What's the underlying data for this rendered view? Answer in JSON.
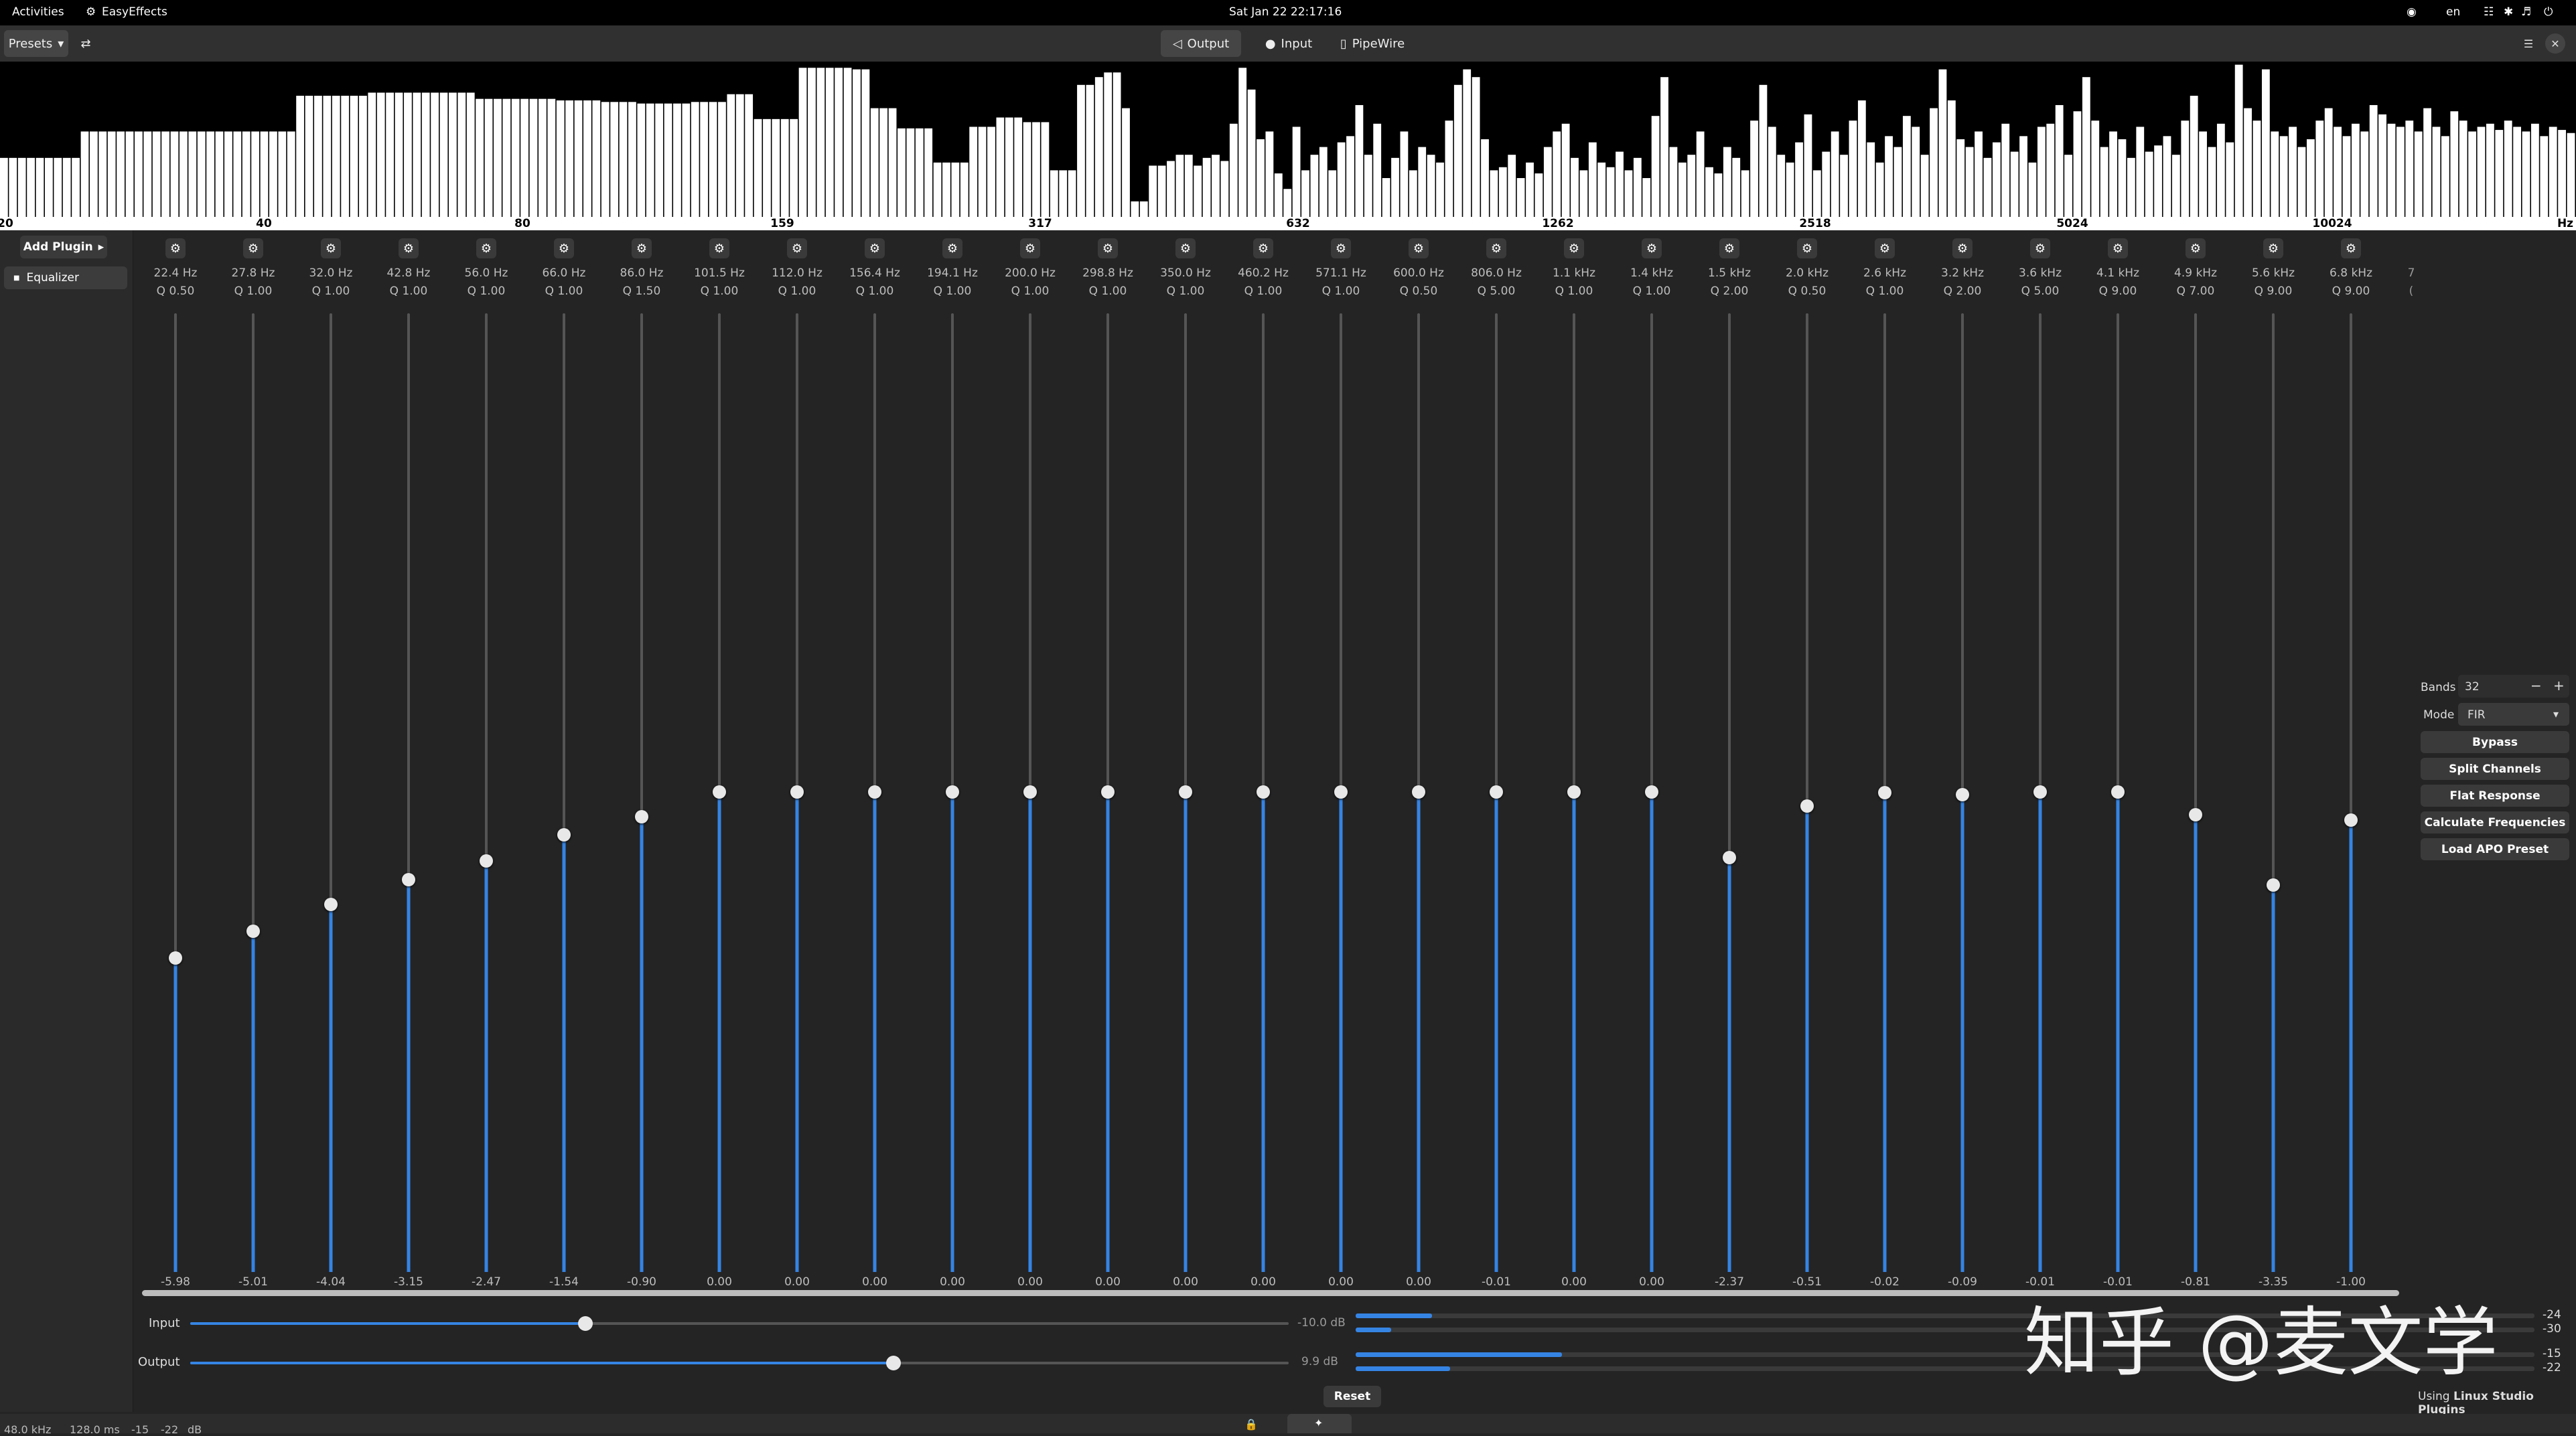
{
  "topbar": {
    "activities": "Activities",
    "app_name": "EasyEffects",
    "clock": "Sat Jan 22  22:17:16",
    "lang": "en"
  },
  "header": {
    "presets_label": "Presets",
    "tabs": [
      {
        "label": "Output",
        "icon": "speaker-icon",
        "active": true
      },
      {
        "label": "Input",
        "icon": "microphone-icon",
        "active": false
      },
      {
        "label": "PipeWire",
        "icon": "pipewire-icon",
        "active": false
      }
    ]
  },
  "spectrum": {
    "ticks": [
      "20",
      "40",
      "80",
      "159",
      "317",
      "632",
      "1262",
      "2518",
      "5024",
      "10024",
      "Hz"
    ],
    "levels": [
      0.38,
      0.38,
      0.38,
      0.38,
      0.38,
      0.38,
      0.38,
      0.38,
      0.38,
      0.55,
      0.55,
      0.55,
      0.55,
      0.55,
      0.55,
      0.55,
      0.55,
      0.55,
      0.55,
      0.55,
      0.55,
      0.55,
      0.55,
      0.55,
      0.55,
      0.55,
      0.55,
      0.55,
      0.55,
      0.55,
      0.55,
      0.55,
      0.55,
      0.78,
      0.78,
      0.78,
      0.78,
      0.78,
      0.78,
      0.78,
      0.78,
      0.8,
      0.8,
      0.8,
      0.8,
      0.8,
      0.8,
      0.8,
      0.8,
      0.8,
      0.8,
      0.8,
      0.8,
      0.76,
      0.76,
      0.76,
      0.76,
      0.76,
      0.76,
      0.76,
      0.76,
      0.76,
      0.75,
      0.75,
      0.75,
      0.75,
      0.75,
      0.74,
      0.74,
      0.74,
      0.74,
      0.73,
      0.73,
      0.73,
      0.73,
      0.73,
      0.73,
      0.74,
      0.74,
      0.74,
      0.74,
      0.79,
      0.79,
      0.79,
      0.63,
      0.63,
      0.63,
      0.63,
      0.63,
      0.96,
      0.96,
      0.96,
      0.96,
      0.96,
      0.96,
      0.95,
      0.95,
      0.7,
      0.7,
      0.7,
      0.57,
      0.57,
      0.57,
      0.57,
      0.35,
      0.35,
      0.35,
      0.35,
      0.58,
      0.58,
      0.58,
      0.64,
      0.64,
      0.64,
      0.61,
      0.61,
      0.61,
      0.3,
      0.3,
      0.3,
      0.85,
      0.85,
      0.9,
      0.93,
      0.93,
      0.7,
      0.1,
      0.1,
      0.33,
      0.33,
      0.36,
      0.4,
      0.4,
      0.33,
      0.38,
      0.4,
      0.36,
      0.6,
      0.96,
      0.82,
      0.5,
      0.55,
      0.28,
      0.18,
      0.58,
      0.3,
      0.4,
      0.45,
      0.3,
      0.48,
      0.52,
      0.72,
      0.4,
      0.6,
      0.25,
      0.38,
      0.55,
      0.3,
      0.45,
      0.4,
      0.35,
      0.62,
      0.85,
      0.95,
      0.9,
      0.5,
      0.3,
      0.32,
      0.4,
      0.25,
      0.35,
      0.28,
      0.45,
      0.55,
      0.6,
      0.38,
      0.3,
      0.48,
      0.35,
      0.32,
      0.42,
      0.3,
      0.38,
      0.25,
      0.65,
      0.9,
      0.45,
      0.35,
      0.4,
      0.55,
      0.32,
      0.28,
      0.45,
      0.38,
      0.3,
      0.62,
      0.85,
      0.58,
      0.4,
      0.35,
      0.48,
      0.66,
      0.3,
      0.42,
      0.55,
      0.4,
      0.62,
      0.75,
      0.48,
      0.35,
      0.52,
      0.45,
      0.65,
      0.58,
      0.4,
      0.7,
      0.95,
      0.75,
      0.5,
      0.45,
      0.55,
      0.38,
      0.48,
      0.6,
      0.42,
      0.52,
      0.35,
      0.58,
      0.6,
      0.72,
      0.4,
      0.68,
      0.9,
      0.62,
      0.45,
      0.55,
      0.5,
      0.38,
      0.58,
      0.42,
      0.46,
      0.52,
      0.4,
      0.62,
      0.78,
      0.55,
      0.45,
      0.6,
      0.48,
      0.98,
      0.7,
      0.62,
      0.95,
      0.55,
      0.52,
      0.58,
      0.45,
      0.5,
      0.62,
      0.7,
      0.58,
      0.52,
      0.6,
      0.55,
      0.72,
      0.66,
      0.6,
      0.58,
      0.62,
      0.55,
      0.7,
      0.58,
      0.52,
      0.68,
      0.62,
      0.55,
      0.58,
      0.6,
      0.56,
      0.62,
      0.58,
      0.55,
      0.6,
      0.52,
      0.58,
      0.56,
      0.54
    ]
  },
  "sidebar": {
    "add_plugin_label": "Add Plugin",
    "plugins": [
      "Equalizer"
    ]
  },
  "bands": [
    {
      "freq": "22.4 Hz",
      "q": "Q 0.50",
      "gain": "-5.98",
      "value": -5.98
    },
    {
      "freq": "27.8 Hz",
      "q": "Q 1.00",
      "gain": "-5.01",
      "value": -5.01
    },
    {
      "freq": "32.0 Hz",
      "q": "Q 1.00",
      "gain": "-4.04",
      "value": -4.04
    },
    {
      "freq": "42.8 Hz",
      "q": "Q 1.00",
      "gain": "-3.15",
      "value": -3.15
    },
    {
      "freq": "56.0 Hz",
      "q": "Q 1.00",
      "gain": "-2.47",
      "value": -2.47
    },
    {
      "freq": "66.0 Hz",
      "q": "Q 1.00",
      "gain": "-1.54",
      "value": -1.54
    },
    {
      "freq": "86.0 Hz",
      "q": "Q 1.50",
      "gain": "-0.90",
      "value": -0.9
    },
    {
      "freq": "101.5 Hz",
      "q": "Q 1.00",
      "gain": "0.00",
      "value": 0.0
    },
    {
      "freq": "112.0 Hz",
      "q": "Q 1.00",
      "gain": "0.00",
      "value": 0.0
    },
    {
      "freq": "156.4 Hz",
      "q": "Q 1.00",
      "gain": "0.00",
      "value": 0.0
    },
    {
      "freq": "194.1 Hz",
      "q": "Q 1.00",
      "gain": "0.00",
      "value": 0.0
    },
    {
      "freq": "200.0 Hz",
      "q": "Q 1.00",
      "gain": "0.00",
      "value": 0.0
    },
    {
      "freq": "298.8 Hz",
      "q": "Q 1.00",
      "gain": "0.00",
      "value": 0.0
    },
    {
      "freq": "350.0 Hz",
      "q": "Q 1.00",
      "gain": "0.00",
      "value": 0.0
    },
    {
      "freq": "460.2 Hz",
      "q": "Q 1.00",
      "gain": "0.00",
      "value": 0.0
    },
    {
      "freq": "571.1 Hz",
      "q": "Q 1.00",
      "gain": "0.00",
      "value": 0.0
    },
    {
      "freq": "600.0 Hz",
      "q": "Q 0.50",
      "gain": "0.00",
      "value": 0.0
    },
    {
      "freq": "806.0 Hz",
      "q": "Q 5.00",
      "gain": "-0.01",
      "value": -0.01
    },
    {
      "freq": "1.1 kHz",
      "q": "Q 1.00",
      "gain": "0.00",
      "value": 0.0
    },
    {
      "freq": "1.4 kHz",
      "q": "Q 1.00",
      "gain": "0.00",
      "value": 0.0
    },
    {
      "freq": "1.5 kHz",
      "q": "Q 2.00",
      "gain": "-2.37",
      "value": -2.37
    },
    {
      "freq": "2.0 kHz",
      "q": "Q 0.50",
      "gain": "-0.51",
      "value": -0.51
    },
    {
      "freq": "2.6 kHz",
      "q": "Q 1.00",
      "gain": "-0.02",
      "value": -0.02
    },
    {
      "freq": "3.2 kHz",
      "q": "Q 2.00",
      "gain": "-0.09",
      "value": -0.09
    },
    {
      "freq": "3.6 kHz",
      "q": "Q 5.00",
      "gain": "-0.01",
      "value": -0.01
    },
    {
      "freq": "4.1 kHz",
      "q": "Q 9.00",
      "gain": "-0.01",
      "value": -0.01
    },
    {
      "freq": "4.9 kHz",
      "q": "Q 7.00",
      "gain": "-0.81",
      "value": -0.81
    },
    {
      "freq": "5.6 kHz",
      "q": "Q 9.00",
      "gain": "-3.35",
      "value": -3.35
    },
    {
      "freq": "6.8 kHz",
      "q": "Q 9.00",
      "gain": "-1.00",
      "value": -1.0
    }
  ],
  "right_panel": {
    "bands_label": "Bands",
    "bands_value": "32",
    "mode_label": "Mode",
    "mode_value": "FIR",
    "buttons": [
      "Bypass",
      "Split Channels",
      "Flat Response",
      "Calculate Frequencies",
      "Load APO Preset"
    ]
  },
  "bottom": {
    "input_label": "Input",
    "input_value": "-10.0 dB",
    "input_level": 0.36,
    "output_label": "Output",
    "output_value": "9.9 dB",
    "output_level": 0.64,
    "meters": [
      {
        "label": "-24",
        "level": 0.065
      },
      {
        "label": "-30",
        "level": 0.03
      },
      {
        "label": "-15",
        "level": 0.175
      },
      {
        "label": "-22",
        "level": 0.08
      }
    ],
    "reset_label": "Reset",
    "using_prefix": "Using",
    "using_name": "Linux Studio Plugins"
  },
  "statusbar": {
    "rate": "48.0 kHz",
    "latency": "128.0 ms",
    "peak_left": "-15",
    "peak_right": "-22",
    "unit": "dB"
  },
  "watermark": "知乎 @麦文学",
  "colors": {
    "accent": "#3584e4",
    "background": "#242424"
  }
}
